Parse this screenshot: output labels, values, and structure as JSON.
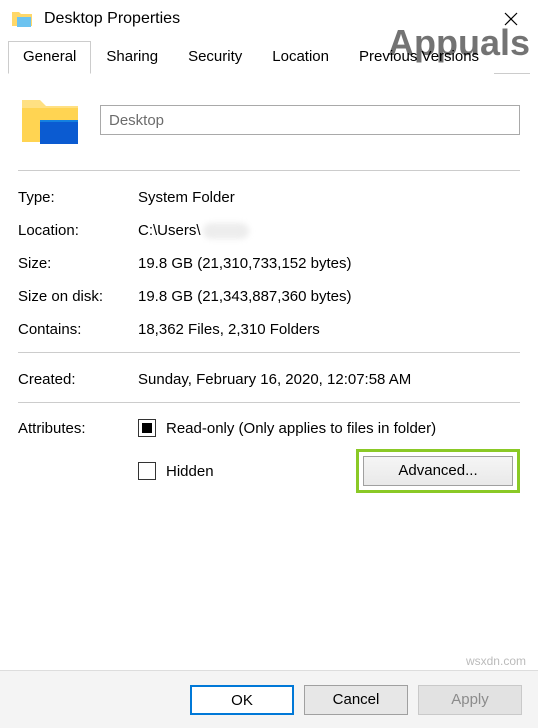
{
  "window": {
    "title": "Desktop Properties"
  },
  "tabs": {
    "t0": "General",
    "t1": "Sharing",
    "t2": "Security",
    "t3": "Location",
    "t4": "Previous Versions"
  },
  "general": {
    "name_value": "Desktop",
    "type_label": "Type:",
    "type_value": "System Folder",
    "location_label": "Location:",
    "location_value": "C:\\Users\\",
    "size_label": "Size:",
    "size_value": "19.8 GB (21,310,733,152 bytes)",
    "sizeondisk_label": "Size on disk:",
    "sizeondisk_value": "19.8 GB (21,343,887,360 bytes)",
    "contains_label": "Contains:",
    "contains_value": "18,362 Files, 2,310 Folders",
    "created_label": "Created:",
    "created_value": "Sunday, February 16, 2020, 12:07:58 AM",
    "attributes_label": "Attributes:",
    "readonly_label": "Read-only (Only applies to files in folder)",
    "hidden_label": "Hidden",
    "advanced_button": "Advanced..."
  },
  "footer": {
    "ok": "OK",
    "cancel": "Cancel",
    "apply": "Apply"
  },
  "watermark": {
    "brand": "Appuals",
    "site": "wsxdn.com"
  }
}
